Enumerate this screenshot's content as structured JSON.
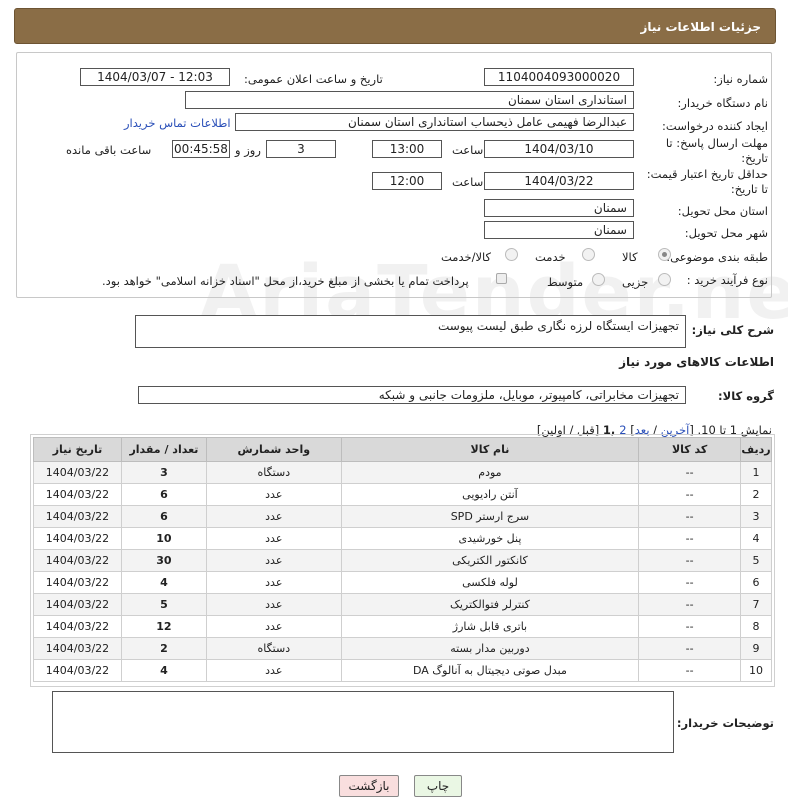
{
  "header": {
    "title": "جزئیات اطلاعات نیاز"
  },
  "form": {
    "need_number_label": "شماره نیاز:",
    "need_number": "1104004093000020",
    "announce_label": "تاریخ و ساعت اعلان عمومی:",
    "announce_value": "1404/03/07 - 12:03",
    "buyer_org_label": "نام دستگاه خریدار:",
    "buyer_org": "استانداری استان سمنان",
    "creator_label": "ایجاد کننده درخواست:",
    "creator": "عبدالرضا فهیمی عامل ذیحساب استانداری استان سمنان",
    "contact_link": "اطلاعات تماس خریدار",
    "deadline_label": "مهلت ارسال پاسخ: تا تاریخ:",
    "deadline_date": "1404/03/10",
    "time_label": "ساعت",
    "deadline_time": "13:00",
    "days_value": "3",
    "days_label": "روز و",
    "remaining_value": "00:45:58",
    "remaining_label": "ساعت باقی مانده",
    "min_price_label": "حداقل تاریخ اعتبار قیمت: تا تاریخ:",
    "min_price_date": "1404/03/22",
    "min_price_time": "12:00",
    "province_label": "استان محل تحویل:",
    "province": "سمنان",
    "city_label": "شهر محل تحویل:",
    "city": "سمنان",
    "category_label": "طبقه بندی موضوعی:",
    "category_options": [
      "کالا",
      "خدمت",
      "کالا/خدمت"
    ],
    "category_selected": "کالا",
    "process_label": "نوع فرآیند خرید :",
    "process_options": [
      "جزیی",
      "متوسط"
    ],
    "payment_note": "پرداخت تمام یا بخشی از مبلغ خرید،از محل \"اسناد خزانه اسلامی\" خواهد بود."
  },
  "summary": {
    "label": "شرح کلی نیاز:",
    "value": "تجهیزات ایستگاه لرزه نگاری طبق لیست پیوست"
  },
  "goods": {
    "section_title": "اطلاعات کالاهای مورد نیاز",
    "group_label": "گروه کالا:",
    "group_value": "تجهیزات مخابراتی، کامپیوتر، موبایل، ملزومات جانبی و شبکه",
    "paging_prefix": "نمایش 1 تا 10. [",
    "paging_last": "آخرین",
    "paging_sep1": " / ",
    "paging_next": "بعد",
    "paging_sep2": "] ",
    "paging_p2": "2",
    "paging_p1": " ,1",
    "paging_suffix": " [قبل / اولین]",
    "columns": [
      "ردیف",
      "کد کالا",
      "نام کالا",
      "واحد شمارش",
      "تعداد / مقدار",
      "تاریخ نیاز"
    ],
    "rows": [
      [
        "1",
        "--",
        "مودم",
        "دستگاه",
        "3",
        "1404/03/22"
      ],
      [
        "2",
        "--",
        "آنتن رادیویی",
        "عدد",
        "6",
        "1404/03/22"
      ],
      [
        "3",
        "--",
        "سرج ارستر SPD",
        "عدد",
        "6",
        "1404/03/22"
      ],
      [
        "4",
        "--",
        "پنل خورشیدی",
        "عدد",
        "10",
        "1404/03/22"
      ],
      [
        "5",
        "--",
        "کانکتور الکتریکی",
        "عدد",
        "30",
        "1404/03/22"
      ],
      [
        "6",
        "--",
        "لوله فلکسی",
        "عدد",
        "4",
        "1404/03/22"
      ],
      [
        "7",
        "--",
        "کنترلر فتوالکتریک",
        "عدد",
        "5",
        "1404/03/22"
      ],
      [
        "8",
        "--",
        "باتری قابل شارژ",
        "عدد",
        "12",
        "1404/03/22"
      ],
      [
        "9",
        "--",
        "دوربین مدار بسته",
        "دستگاه",
        "2",
        "1404/03/22"
      ],
      [
        "10",
        "--",
        "مبدل صوتی دیجیتال به آنالوگ DA",
        "عدد",
        "4",
        "1404/03/22"
      ]
    ]
  },
  "buyer_notes": {
    "label": "توضیحات خریدار:",
    "value": ""
  },
  "buttons": {
    "print": "چاپ",
    "back": "بازگشت"
  },
  "watermark": "AriaTender.neT"
}
